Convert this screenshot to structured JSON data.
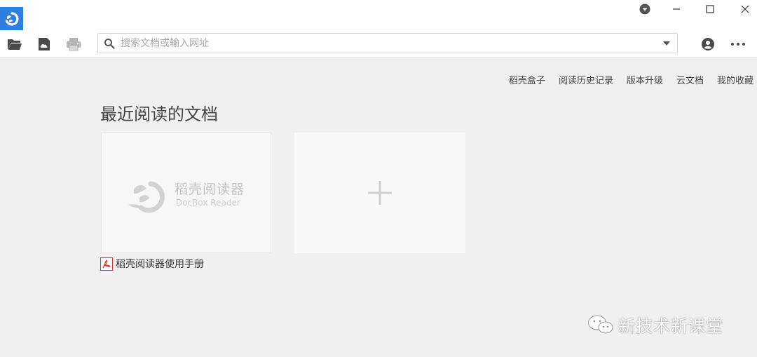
{
  "window": {
    "controls": {
      "menu": "▾",
      "minimize": "–",
      "maximize": "□",
      "close": "✕"
    }
  },
  "toolbar": {
    "tools": [
      "folder-open-icon",
      "cloud-save-icon",
      "printer-icon"
    ],
    "search": {
      "value": "",
      "placeholder": "搜索文档或输入网址"
    },
    "right": [
      "user-icon",
      "more-icon"
    ]
  },
  "toplinks": [
    "稻壳盒子",
    "阅读历史记录",
    "版本升级",
    "云文档",
    "我的收藏"
  ],
  "main": {
    "section_title": "最近阅读的文档",
    "recent_doc": {
      "thumbnail_brand_name": "稻壳阅读器",
      "thumbnail_brand_en": "DocBox Reader",
      "filename": "稻壳阅读器使用手册",
      "file_icon": "pdf-icon"
    },
    "add_card": {
      "icon": "plus-icon"
    }
  },
  "watermark": {
    "text": "新技术新课堂",
    "icon": "wechat-icon"
  },
  "colors": {
    "accent": "#2f7fe0",
    "pdf": "#d9372b",
    "background": "#f0f0f0"
  }
}
